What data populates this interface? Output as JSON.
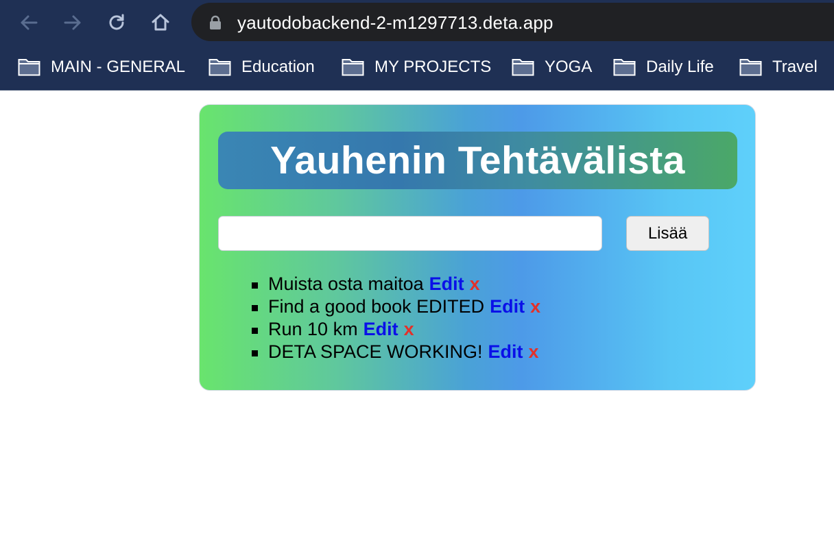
{
  "browser": {
    "url": "yautodobackend-2-m1297713.deta.app",
    "bookmarks": [
      {
        "label": "MAIN - GENERAL"
      },
      {
        "label": "Education"
      },
      {
        "label": "MY PROJECTS"
      },
      {
        "label": "YOGA"
      },
      {
        "label": "Daily Life"
      },
      {
        "label": "Travel"
      }
    ]
  },
  "app": {
    "title": "Yauhenin Tehtävälista",
    "input": {
      "value": "",
      "placeholder": ""
    },
    "add_label": "Lisää",
    "todos": [
      {
        "text": "Muista osta maitoa",
        "edit": "Edit",
        "delete": "x"
      },
      {
        "text": "Find a good book EDITED",
        "edit": "Edit",
        "delete": "x"
      },
      {
        "text": "Run 10 km",
        "edit": "Edit",
        "delete": "x"
      },
      {
        "text": "DETA SPACE WORKING!",
        "edit": "Edit",
        "delete": "x"
      }
    ]
  },
  "colors": {
    "chrome": "#1f3054",
    "edit_link": "#0a10e8",
    "delete_link": "#e3312a"
  }
}
